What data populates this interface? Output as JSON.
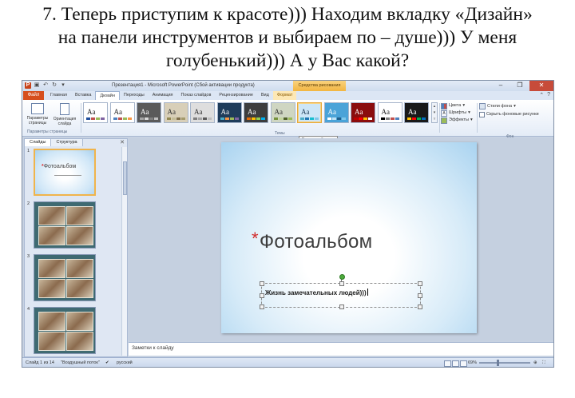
{
  "caption": {
    "line1": "7. Теперь приступим к красоте))) Находим вкладку «Дизайн»",
    "line2": "на панели инструментов и выбираем по – душе))) У меня",
    "line3": "голубенький))) А у Вас какой?"
  },
  "window": {
    "title": "Презентация1 - Microsoft PowerPoint (Сбой активации продукта)",
    "context_group": "Средства рисования",
    "pp_letter": "P",
    "min": "–",
    "max": "❐",
    "close": "✕"
  },
  "tabs": {
    "file": "Файл",
    "items": [
      "Главная",
      "Вставка",
      "Дизайн",
      "Переходы",
      "Анимация",
      "Показ слайдов",
      "Рецензирование",
      "Вид",
      "Формат"
    ],
    "active_index": 2,
    "help": "?"
  },
  "ribbon": {
    "page_setup": "Параметры страницы",
    "orientation": "Ориентация слайда",
    "page_group": "Параметры страницы",
    "themes_label": "Темы",
    "theme_sample": "Aa",
    "themes": [
      {
        "bg": "#ffffff",
        "fg": "#222222",
        "bars": [
          "#1f4e9c",
          "#c0504d",
          "#9bbb59",
          "#8064a2"
        ]
      },
      {
        "bg": "#ffffff",
        "fg": "#222222",
        "bars": [
          "#4f81bd",
          "#c0504d",
          "#9bbb59",
          "#f79646"
        ]
      },
      {
        "bg": "#5a5a5a",
        "fg": "#ffffff",
        "bars": [
          "#a5a5a5",
          "#d9d9d9",
          "#7f7f7f",
          "#bfbfbf"
        ]
      },
      {
        "bg": "#d8cfb8",
        "fg": "#333333",
        "bars": [
          "#938953",
          "#c4bd97",
          "#7f6f4a",
          "#a49a6c"
        ]
      },
      {
        "bg": "#dedede",
        "fg": "#333333",
        "bars": [
          "#7f7f7f",
          "#a5a5a5",
          "#595959",
          "#bfbfbf"
        ]
      },
      {
        "bg": "#1f3c5a",
        "fg": "#ffffff",
        "bars": [
          "#4bacc6",
          "#f79646",
          "#9bbb59",
          "#8064a2"
        ]
      },
      {
        "bg": "#3d3d3d",
        "fg": "#ffffff",
        "bars": [
          "#e46c0a",
          "#ffc000",
          "#92d050",
          "#00b0f0"
        ]
      },
      {
        "bg": "#cfd6c2",
        "fg": "#333333",
        "bars": [
          "#76923c",
          "#c3d69b",
          "#4f6228",
          "#9bbb59"
        ]
      },
      {
        "bg": "#cde6f7",
        "fg": "#1f3b55",
        "bars": [
          "#4bacc6",
          "#1f77b4",
          "#17becf",
          "#7fc7e9"
        ]
      },
      {
        "bg": "#4aa3d8",
        "fg": "#ffffff",
        "bars": [
          "#ffffff",
          "#bfe2f5",
          "#1f5f8b",
          "#7fc7e9"
        ]
      },
      {
        "bg": "#8b0d0d",
        "fg": "#ffffff",
        "bars": [
          "#c00000",
          "#ff0000",
          "#ffc000",
          "#ffffff"
        ]
      },
      {
        "bg": "#ffffff",
        "fg": "#222222",
        "bars": [
          "#000000",
          "#7f7f7f",
          "#c0504d",
          "#4f81bd"
        ]
      },
      {
        "bg": "#1a1a1a",
        "fg": "#ffffff",
        "bars": [
          "#ffc000",
          "#ff0000",
          "#00b050",
          "#0070c0"
        ]
      }
    ],
    "hover_index": 8,
    "colors": "Цвета",
    "fonts": "Шрифты",
    "effects": "Эффекты",
    "bg_styles": "Стили фона",
    "hide_bg": "Скрыть фоновые рисунки",
    "bg_group": "Фон",
    "tooltip": "Воздушный поток"
  },
  "pane": {
    "tab_slides": "Слайды",
    "tab_outline": "Структура",
    "close": "✕",
    "thumb1_title": "Фотоальбом",
    "thumb1_star": "*",
    "numbers": [
      "1",
      "2",
      "3",
      "4"
    ]
  },
  "slide": {
    "star": "*",
    "title": "Фотоальбом",
    "subtitle": "Жизнь замечательных людей)))"
  },
  "notes": {
    "placeholder": "Заметки к слайду"
  },
  "status": {
    "slide_of": "Слайд 1 из 14",
    "theme": "\"Воздушный поток\"",
    "language": "русский",
    "zoom": "69%",
    "zoom_level": 0.69
  }
}
